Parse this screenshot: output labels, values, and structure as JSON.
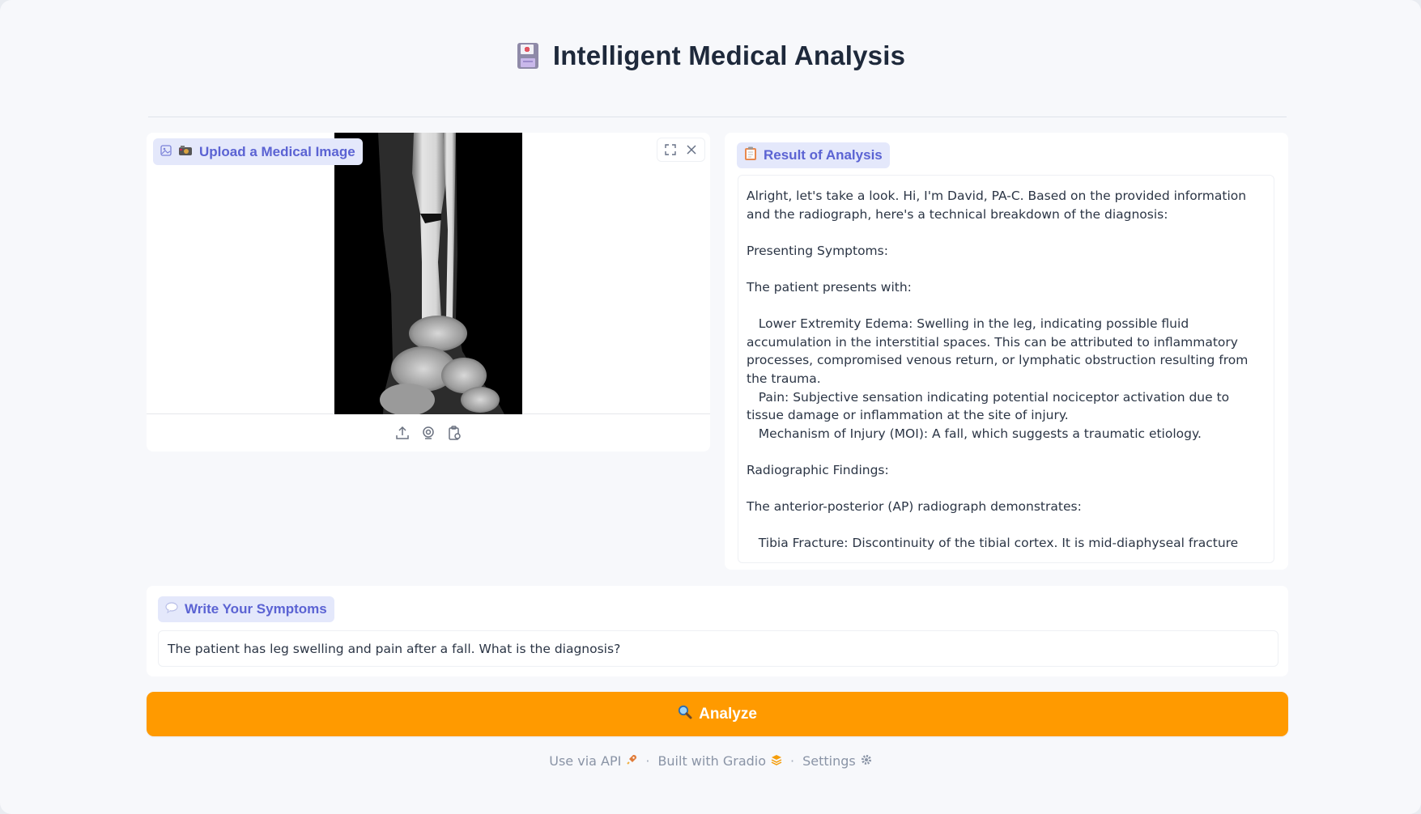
{
  "app": {
    "title": "Intelligent Medical Analysis",
    "accent": "#ff9a00",
    "label_color": "#5b63d3",
    "label_bg": "#e4e8fb"
  },
  "upload": {
    "label": "Upload a Medical Image",
    "label_icons": [
      "image-icon",
      "camera-icon"
    ],
    "image": "leg x-ray radiograph",
    "corner_buttons": [
      "fullscreen-icon",
      "close-icon"
    ],
    "source_buttons": [
      "upload-icon",
      "webcam-icon",
      "clipboard-icon"
    ]
  },
  "result": {
    "label": "Result of Analysis",
    "label_icon": "clipboard-icon",
    "text": "Alright, let's take a look. Hi, I'm David, PA-C. Based on the provided information and the radiograph, here's a technical breakdown of the diagnosis:\n\nPresenting Symptoms:\n\nThe patient presents with:\n\n   Lower Extremity Edema: Swelling in the leg, indicating possible fluid accumulation in the interstitial spaces. This can be attributed to inflammatory processes, compromised venous return, or lymphatic obstruction resulting from the trauma.\n   Pain: Subjective sensation indicating potential nociceptor activation due to tissue damage or inflammation at the site of injury.\n   Mechanism of Injury (MOI): A fall, which suggests a traumatic etiology.\n\nRadiographic Findings:\n\nThe anterior-posterior (AP) radiograph demonstrates:\n\n   Tibia Fracture: Discontinuity of the tibial cortex. It is mid-diaphyseal fracture"
  },
  "symptoms": {
    "label": "Write Your Symptoms",
    "label_icon": "speech-bubble-icon",
    "value": "The patient has leg swelling and pain after a fall. What is the diagnosis?"
  },
  "analyze": {
    "label": "Analyze",
    "icon": "magnifier-icon"
  },
  "footer": {
    "api": "Use via API",
    "built": "Built with Gradio",
    "settings": "Settings",
    "separator": "·"
  }
}
